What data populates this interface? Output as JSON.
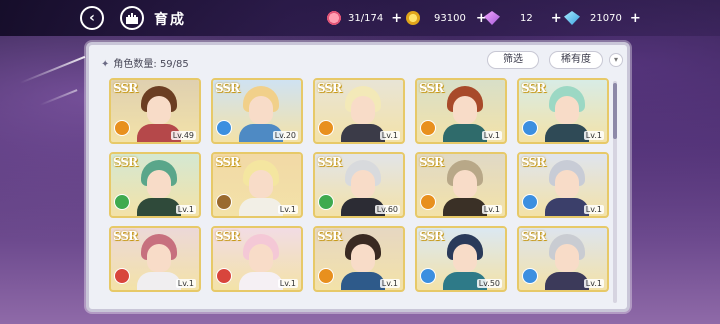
{
  "header": {
    "back_icon": "chevron-left-icon",
    "home_icon": "castle-icon",
    "title": "育成"
  },
  "resources": [
    {
      "icon": "candy-icon",
      "value": "31/174",
      "plus": "+",
      "color": "#e05577"
    },
    {
      "icon": "coin-icon",
      "value": "93100",
      "plus": "+",
      "color": "#e0a51a"
    },
    {
      "icon": "pink-gem-icon",
      "value": "12",
      "plus": "+",
      "color": "#c36be6"
    },
    {
      "icon": "blue-gem-icon",
      "value": "21070",
      "plus": "+",
      "color": "#3aa2e0"
    }
  ],
  "panel": {
    "count_label": "角色数量: 59/85",
    "filter_label": "筛选",
    "rarity_sort_label": "稀有度",
    "sort_toggle_icon": "chevron-down-icon"
  },
  "characters": [
    {
      "rarity": "SSR",
      "level": "Lv.49",
      "element": "orange",
      "bg": "#dfd0b0",
      "hair": "#6b3e22",
      "outfit": "#b5484a"
    },
    {
      "rarity": "SSR",
      "level": "Lv.20",
      "element": "blue",
      "bg": "#cfe2f2",
      "hair": "#f1d08a",
      "outfit": "#4e8ac4"
    },
    {
      "rarity": "SSR",
      "level": "Lv.1",
      "element": "orange",
      "bg": "#e8e4d6",
      "hair": "#f3e9b8",
      "outfit": "#3b3b48"
    },
    {
      "rarity": "SSR",
      "level": "Lv.1",
      "element": "orange",
      "bg": "#d8dfc8",
      "hair": "#a84a2a",
      "outfit": "#2f6b6b"
    },
    {
      "rarity": "SSR",
      "level": "Lv.1",
      "element": "blue",
      "bg": "#d8ece6",
      "hair": "#9cd8c4",
      "outfit": "#2f4a56"
    },
    {
      "rarity": "SSR",
      "level": "Lv.1",
      "element": "green",
      "bg": "#d4e8d2",
      "hair": "#5aa68a",
      "outfit": "#2f4a3a"
    },
    {
      "rarity": "SSR",
      "level": "Lv.1",
      "element": "brown",
      "bg": "#f2d9a6",
      "hair": "#f4e6a0",
      "outfit": "#f2efe6"
    },
    {
      "rarity": "SSR",
      "level": "Lv.60",
      "element": "green",
      "bg": "#e2e4e8",
      "hair": "#d8dadd",
      "outfit": "#2c2c34"
    },
    {
      "rarity": "SSR",
      "level": "Lv.1",
      "element": "orange",
      "bg": "#e0d9c6",
      "hair": "#b8a888",
      "outfit": "#3a3026"
    },
    {
      "rarity": "SSR",
      "level": "Lv.1",
      "element": "blue",
      "bg": "#dfe4ee",
      "hair": "#c8ccd6",
      "outfit": "#3b3f6a"
    },
    {
      "rarity": "SSR",
      "level": "Lv.1",
      "element": "red",
      "bg": "#ecd8d8",
      "hair": "#c7707e",
      "outfit": "#f0eef0"
    },
    {
      "rarity": "SSR",
      "level": "Lv.1",
      "element": "red",
      "bg": "#f2dce4",
      "hair": "#f4c8d6",
      "outfit": "#f5f0f4"
    },
    {
      "rarity": "SSR",
      "level": "Lv.1",
      "element": "orange",
      "bg": "#e6d7c2",
      "hair": "#3a2a22",
      "outfit": "#2e5a8a"
    },
    {
      "rarity": "SSR",
      "level": "Lv.50",
      "element": "blue",
      "bg": "#dbe8f2",
      "hair": "#2a3a5a",
      "outfit": "#2e7a88"
    },
    {
      "rarity": "SSR",
      "level": "Lv.1",
      "element": "blue",
      "bg": "#dde4ee",
      "hair": "#c9ccd2",
      "outfit": "#3c3a5a"
    }
  ],
  "element_colors": {
    "orange": "#e8901e",
    "blue": "#3c8fe0",
    "green": "#3faa4f",
    "brown": "#9a6a2e",
    "red": "#d8453c"
  }
}
